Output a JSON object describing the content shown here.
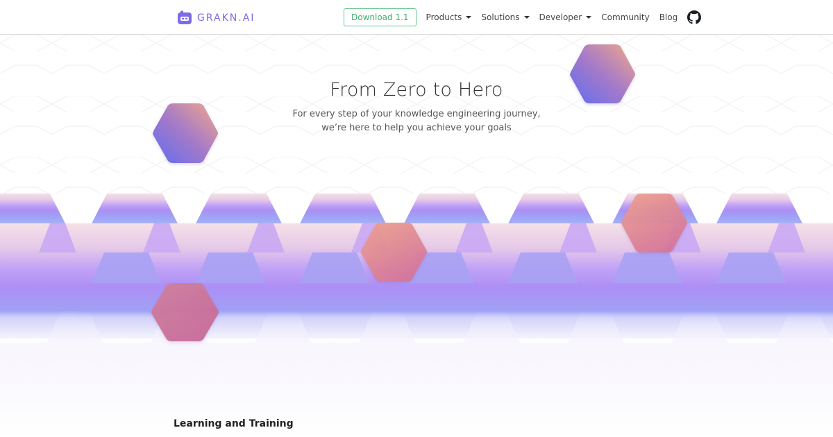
{
  "brand": {
    "name": "GRAKN.AI",
    "accent": "#7f6be8"
  },
  "nav": {
    "download_label": "Download 1.1",
    "items": [
      {
        "label": "Products",
        "has_dropdown": true
      },
      {
        "label": "Solutions",
        "has_dropdown": true
      },
      {
        "label": "Developer",
        "has_dropdown": true
      },
      {
        "label": "Community",
        "has_dropdown": false
      },
      {
        "label": "Blog",
        "has_dropdown": false
      }
    ],
    "github_icon": "github-icon"
  },
  "hero": {
    "title": "From Zero to Hero",
    "subtitle_line1": "For every step of your knowledge engineering journey,",
    "subtitle_line2": "we’re here to help you achieve your goals"
  },
  "sections": {
    "learning_title": "Learning and Training"
  },
  "colors": {
    "band_top": "#f3dbe3",
    "band_mid": "#b38cf4",
    "band_bottom": "#98a4f7",
    "hex_blue": "#6f73ee",
    "hex_peach": "#f0a890",
    "hex_rose": "#cf6f98",
    "download_green": "#3fb06e"
  }
}
